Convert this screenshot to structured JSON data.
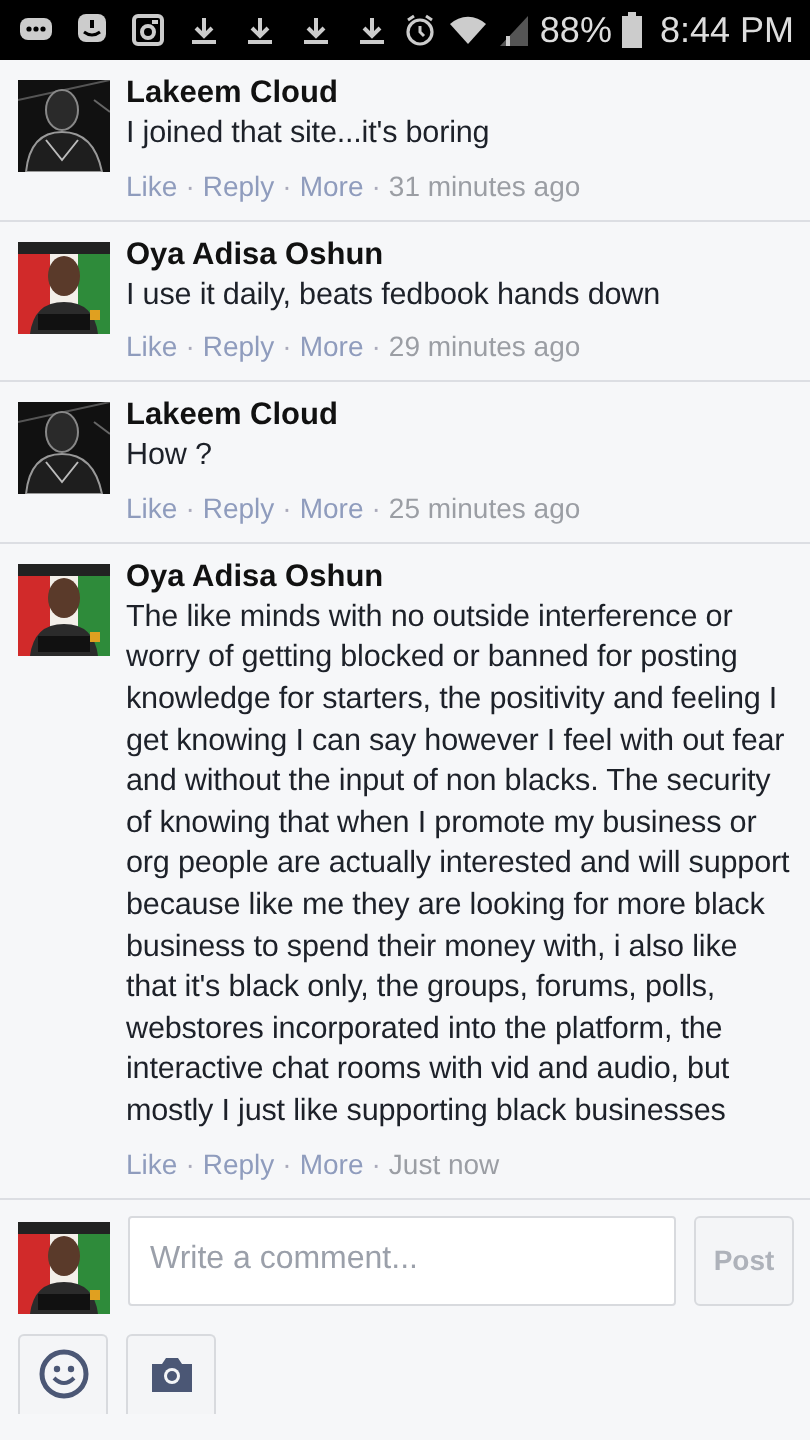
{
  "status_bar": {
    "notifications": [
      {
        "kind": "chat"
      },
      {
        "kind": "messenger"
      },
      {
        "kind": "instagram"
      },
      {
        "kind": "download"
      },
      {
        "kind": "download"
      },
      {
        "kind": "download"
      },
      {
        "kind": "download"
      }
    ],
    "battery_text": "88%",
    "time": "8:44 PM"
  },
  "separator": "·",
  "comments": [
    {
      "author": "Lakeem Cloud",
      "avatar": {
        "kind": "sketch"
      },
      "text": "I joined that site...it's boring",
      "actions": [
        "Like",
        "Reply",
        "More"
      ],
      "time": "31 minutes ago"
    },
    {
      "author": "Oya Adisa Oshun",
      "avatar": {
        "kind": "poster"
      },
      "text": "I use it daily, beats fedbook hands down",
      "actions": [
        "Like",
        "Reply",
        "More"
      ],
      "time": "29 minutes ago"
    },
    {
      "author": "Lakeem Cloud",
      "avatar": {
        "kind": "sketch"
      },
      "text": "How ?",
      "actions": [
        "Like",
        "Reply",
        "More"
      ],
      "time": "25 minutes ago"
    },
    {
      "author": "Oya Adisa Oshun",
      "avatar": {
        "kind": "poster"
      },
      "text": "The like minds with no outside interference or worry of getting blocked or banned for posting knowledge for starters, the positivity and feeling I get knowing I can say however I feel with out fear and without the input of non blacks. The security of knowing that when I promote my business or org people are actually interested and will support because like me they are looking for more black business to spend their money with, i also like that it's black only, the groups, forums, polls, webstores incorporated into the platform, the interactive chat rooms with vid and audio, but mostly I just like supporting black businesses",
      "actions": [
        "Like",
        "Reply",
        "More"
      ],
      "time": "Just now"
    }
  ],
  "composer": {
    "avatar": {
      "kind": "poster"
    },
    "placeholder": "Write a comment...",
    "post_label": "Post",
    "disabled": true
  }
}
